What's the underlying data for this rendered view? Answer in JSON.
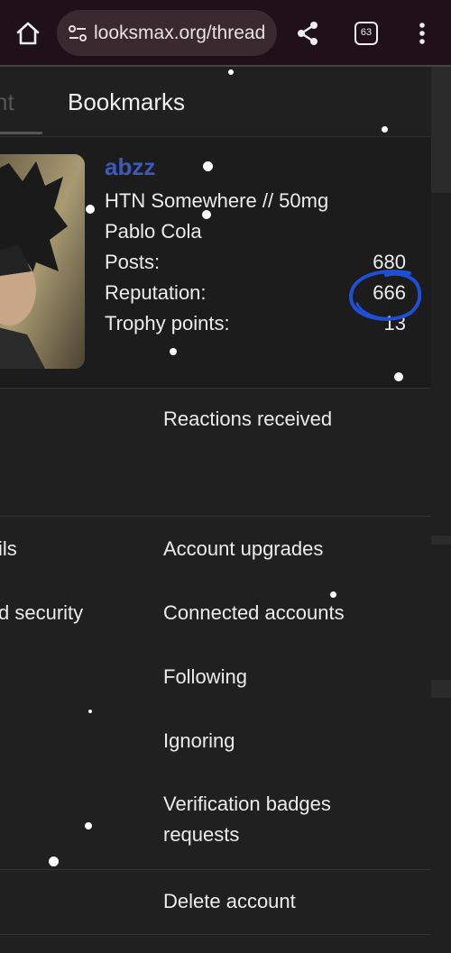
{
  "browser": {
    "url": "looksmax.org/thread",
    "tab_count": "63"
  },
  "tabs": {
    "partial_label": "nt",
    "bookmarks_label": "Bookmarks"
  },
  "profile": {
    "username": "abzz",
    "line1": "HTN Somewhere // 50mg",
    "line2": "Pablo Cola",
    "stats": [
      {
        "label": "Posts:",
        "value": "680"
      },
      {
        "label": "Reputation:",
        "value": "666"
      },
      {
        "label": "Trophy points:",
        "value": "13"
      }
    ]
  },
  "menu": {
    "reactions_received": "Reactions received",
    "left_partial": [
      "ils",
      "d security"
    ],
    "right_items": [
      "Account upgrades",
      "Connected accounts",
      "Following",
      "Ignoring",
      "Verification badges requests"
    ],
    "delete_account": "Delete account"
  },
  "colors": {
    "username": "#3d5ab8",
    "annotation_circle": "#1f4fd6"
  }
}
